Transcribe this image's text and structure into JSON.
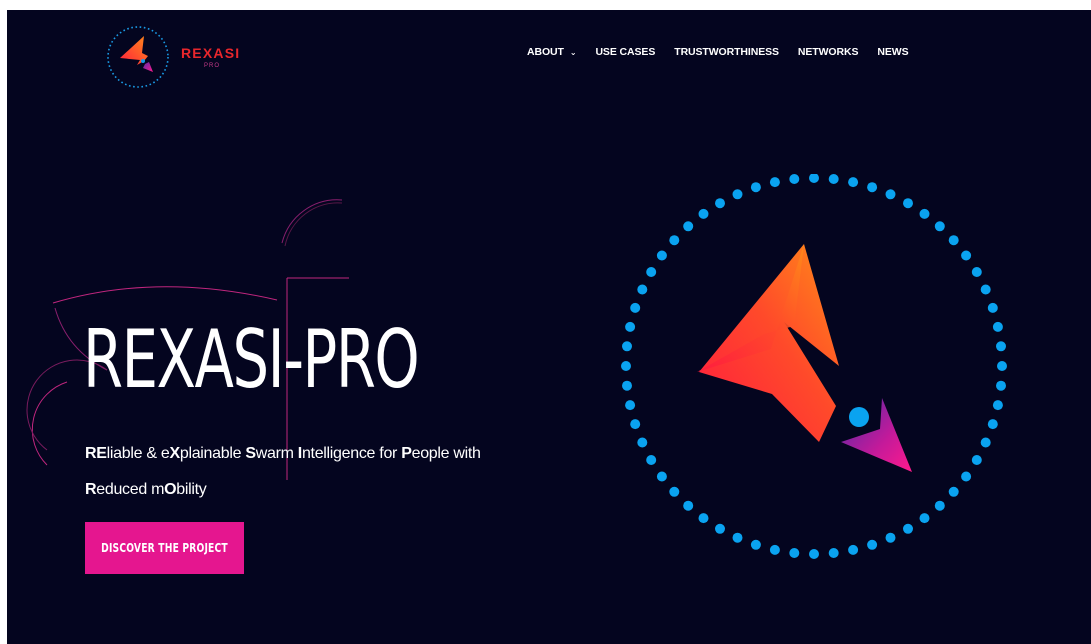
{
  "brand": {
    "name": "REXASI",
    "sub": "PRO"
  },
  "nav": {
    "items": [
      {
        "label": "ABOUT",
        "has_dropdown": true,
        "chevron": "⌄"
      },
      {
        "label": "USE CASES"
      },
      {
        "label": "TRUSTWORTHINESS"
      },
      {
        "label": "NETWORKS"
      },
      {
        "label": "NEWS"
      }
    ]
  },
  "hero": {
    "title": "REXASI-PRO",
    "tagline": [
      {
        "text": "RE",
        "bold": true
      },
      {
        "text": "liable & e",
        "bold": false
      },
      {
        "text": "X",
        "bold": true
      },
      {
        "text": "plainable ",
        "bold": false
      },
      {
        "text": "S",
        "bold": true
      },
      {
        "text": "warm ",
        "bold": false
      },
      {
        "text": "I",
        "bold": true
      },
      {
        "text": "ntelligence for ",
        "bold": false
      },
      {
        "text": "P",
        "bold": true
      },
      {
        "text": "eople with ",
        "bold": false
      },
      {
        "text": "R",
        "bold": true
      },
      {
        "text": "educed m",
        "bold": false
      },
      {
        "text": "O",
        "bold": true
      },
      {
        "text": "bility",
        "bold": false
      }
    ],
    "cta": {
      "part1": "DISCOVER",
      "part2": "THE PROJECT"
    }
  },
  "colors": {
    "background": "#04051f",
    "accent_pink": "#e5168f",
    "dot_blue": "#0aa3f0",
    "logo_red": "#e8262c",
    "arrow_orange": "#ff7a1a",
    "arrow_red": "#ff1f3d"
  },
  "icons": {
    "logo": "rexasi-star-logo-icon",
    "emblem": "rexasi-star-emblem-icon",
    "dropdown": "chevron-down-icon"
  }
}
